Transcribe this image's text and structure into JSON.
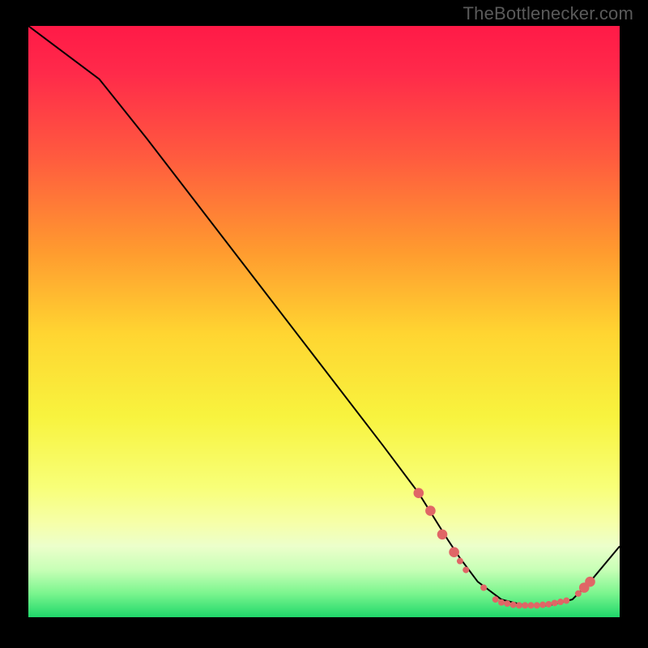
{
  "watermark": "TheBottlenecker.com",
  "chart_data": {
    "type": "line",
    "title": "",
    "xlabel": "",
    "ylabel": "",
    "xlim": [
      0,
      100
    ],
    "ylim": [
      0,
      100
    ],
    "background_gradient": {
      "stops": [
        {
          "offset": 0.0,
          "color": "#ff1a47"
        },
        {
          "offset": 0.08,
          "color": "#ff2a4a"
        },
        {
          "offset": 0.22,
          "color": "#ff5a3f"
        },
        {
          "offset": 0.38,
          "color": "#ff9a2f"
        },
        {
          "offset": 0.52,
          "color": "#ffd531"
        },
        {
          "offset": 0.66,
          "color": "#f8f33e"
        },
        {
          "offset": 0.78,
          "color": "#f8ff78"
        },
        {
          "offset": 0.84,
          "color": "#f6ffa8"
        },
        {
          "offset": 0.88,
          "color": "#ecffcb"
        },
        {
          "offset": 0.92,
          "color": "#c7ffb6"
        },
        {
          "offset": 0.96,
          "color": "#7af58e"
        },
        {
          "offset": 1.0,
          "color": "#1fd76a"
        }
      ]
    },
    "series": [
      {
        "name": "bottleneck-curve",
        "color": "#000000",
        "stroke_width": 2,
        "x": [
          0,
          4,
          8,
          12,
          20,
          30,
          40,
          50,
          60,
          66,
          71,
          73,
          76,
          80,
          84,
          88,
          92,
          95,
          100
        ],
        "y": [
          100,
          97,
          94,
          91,
          81,
          68,
          55,
          42,
          29,
          21,
          13,
          10,
          6,
          3,
          2,
          2,
          3,
          6,
          12
        ]
      }
    ],
    "markers": {
      "color": "#e06666",
      "radius_small": 4.0,
      "radius_big": 6.3,
      "points": [
        {
          "x": 66,
          "y": 21,
          "big": true
        },
        {
          "x": 68,
          "y": 18,
          "big": true
        },
        {
          "x": 70,
          "y": 14,
          "big": true
        },
        {
          "x": 72,
          "y": 11,
          "big": true
        },
        {
          "x": 73,
          "y": 9.5,
          "big": false
        },
        {
          "x": 74,
          "y": 8,
          "big": false
        },
        {
          "x": 77,
          "y": 5,
          "big": false
        },
        {
          "x": 79,
          "y": 3,
          "big": false
        },
        {
          "x": 80,
          "y": 2.5,
          "big": false
        },
        {
          "x": 81,
          "y": 2.3,
          "big": false
        },
        {
          "x": 82,
          "y": 2.1,
          "big": false
        },
        {
          "x": 83,
          "y": 2.0,
          "big": false
        },
        {
          "x": 84,
          "y": 2.0,
          "big": false
        },
        {
          "x": 85,
          "y": 2.0,
          "big": false
        },
        {
          "x": 86,
          "y": 2.0,
          "big": false
        },
        {
          "x": 87,
          "y": 2.1,
          "big": false
        },
        {
          "x": 88,
          "y": 2.2,
          "big": false
        },
        {
          "x": 89,
          "y": 2.4,
          "big": false
        },
        {
          "x": 90,
          "y": 2.6,
          "big": false
        },
        {
          "x": 91,
          "y": 2.8,
          "big": false
        },
        {
          "x": 93,
          "y": 4,
          "big": false
        },
        {
          "x": 94,
          "y": 5,
          "big": true
        },
        {
          "x": 95,
          "y": 6,
          "big": true
        }
      ]
    }
  }
}
